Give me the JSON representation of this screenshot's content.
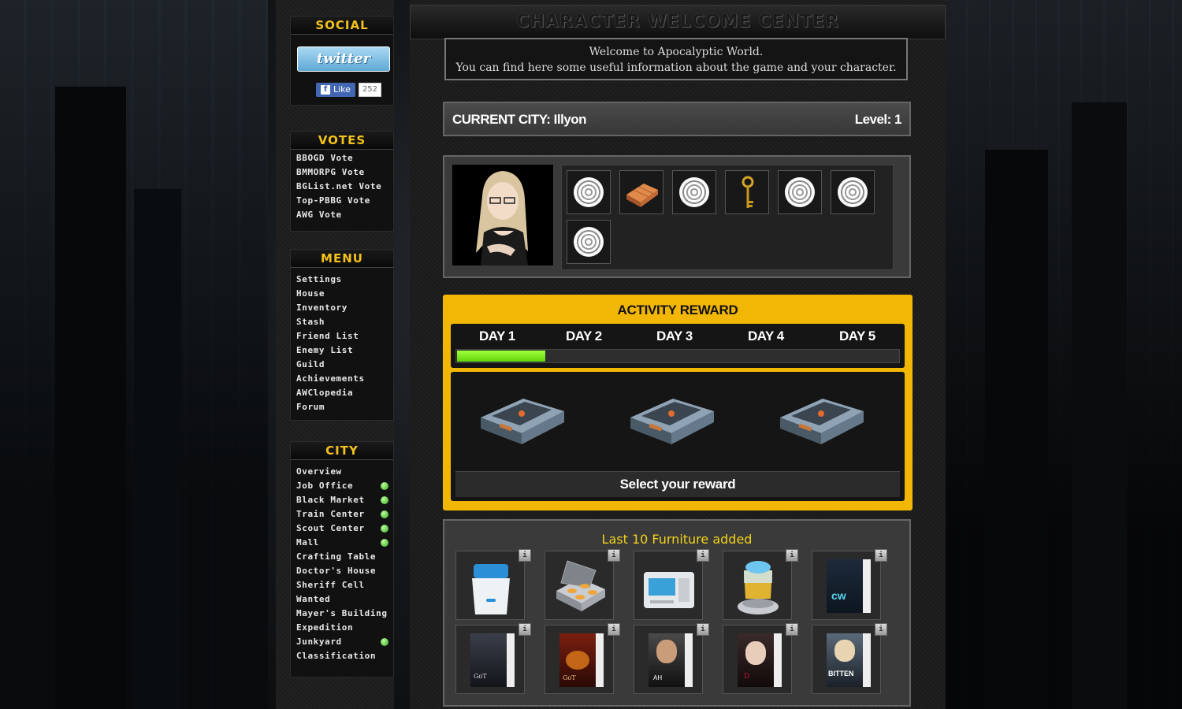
{
  "social": {
    "heading": "SOCIAL",
    "twitter_label": "twitter",
    "fb_like": "Like",
    "fb_count": "252"
  },
  "votes": {
    "heading": "VOTES",
    "items": [
      "BBOGD Vote",
      "BMMORPG Vote",
      "BGList.net Vote",
      "Top-PBBG Vote",
      "AWG Vote"
    ]
  },
  "menu": {
    "heading": "MENU",
    "items": [
      "Settings",
      "House",
      "Inventory",
      "Stash",
      "Friend List",
      "Enemy List",
      "Guild",
      "Achievements",
      "AWClopedia",
      "Forum"
    ]
  },
  "city": {
    "heading": "CITY",
    "items": [
      {
        "label": "Overview",
        "online": false
      },
      {
        "label": "Job Office",
        "online": true
      },
      {
        "label": "Black Market",
        "online": true
      },
      {
        "label": "Train Center",
        "online": true
      },
      {
        "label": "Scout Center",
        "online": true
      },
      {
        "label": "Mall",
        "online": true
      },
      {
        "label": "Crafting Table",
        "online": false
      },
      {
        "label": "Doctor's House",
        "online": false
      },
      {
        "label": "Sheriff Cell",
        "online": false
      },
      {
        "label": "Wanted",
        "online": false
      },
      {
        "label": "Mayer's Building",
        "online": false
      },
      {
        "label": "Expedition",
        "online": false
      },
      {
        "label": "Junkyard",
        "online": true
      },
      {
        "label": "Classification",
        "online": false
      }
    ],
    "status_color": "#3aa81f"
  },
  "main": {
    "title": "CHARACTER WELCOME CENTER",
    "welcome_line1": "Welcome to Apocalyptic World.",
    "welcome_line2": "You can find here some useful information about the game and your character.",
    "current_city": "CURRENT CITY: Illyon",
    "level": "Level: 1"
  },
  "inventory": {
    "slots": [
      "target-icon",
      "brick-icon",
      "target-icon",
      "key-icon",
      "target-icon",
      "target-icon",
      "target-icon"
    ]
  },
  "activity": {
    "title": "ACTIVITY REWARD",
    "days": [
      "DAY 1",
      "DAY 2",
      "DAY 3",
      "DAY 4",
      "DAY 5"
    ],
    "progress": 0.2,
    "select_label": "Select your reward",
    "accent": "#f2b705",
    "progress_color": "#7ee21a"
  },
  "furniture": {
    "title": "Last 10 Furniture added",
    "info_label": "i",
    "items": [
      "sterilizer-icon",
      "stove-icon",
      "fax-machine-icon",
      "blender-icon",
      "dvd-cw-icon",
      "dvd-game-of-thrones-icon",
      "dvd-game-of-thrones-2-icon",
      "dvd-almost-human-icon",
      "dvd-dracula-icon",
      "dvd-bitten-icon"
    ],
    "dvd_labels": {
      "dvd-cw-icon": "cw",
      "dvd-game-of-thrones-icon": "GoT",
      "dvd-game-of-thrones-2-icon": "GoT",
      "dvd-almost-human-icon": "AH",
      "dvd-dracula-icon": "D",
      "dvd-bitten-icon": "BITTEN"
    }
  }
}
